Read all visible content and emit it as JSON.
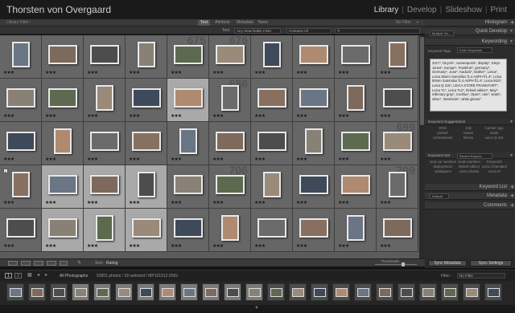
{
  "window": {
    "title": "Thorsten von Overgaard"
  },
  "modules": [
    {
      "label": "Library",
      "active": true
    },
    {
      "label": "Develop",
      "active": false
    },
    {
      "label": "Slideshow",
      "active": false
    },
    {
      "label": "Print",
      "active": false
    }
  ],
  "filter_bar": {
    "title": "Library Filter :",
    "tabs": [
      "Text",
      "Attribute",
      "Metadata",
      "None"
    ],
    "active_tab": "Text",
    "no_filter": "No Filter",
    "text_label": "Text",
    "field_select": "Any Searchable Field",
    "rule_select": "Contains All"
  },
  "grid": {
    "row_numbers": [
      [
        "",
        "",
        "",
        "",
        "675",
        "676",
        "",
        "",
        "",
        ""
      ],
      [
        "",
        "",
        "",
        "",
        "",
        "686",
        "",
        "",
        "",
        ""
      ],
      [
        "",
        "",
        "",
        "",
        "",
        "",
        "",
        "",
        "",
        "699"
      ],
      [
        "",
        "",
        "",
        "",
        "",
        "706",
        "",
        "",
        "",
        "709"
      ],
      [
        "",
        "",
        "",
        "",
        "",
        "",
        "",
        "",
        "",
        ""
      ]
    ],
    "badge_value": "2"
  },
  "toolbar": {
    "sort_label": "Sort:",
    "sort_value": "Rating",
    "thumbnails_label": "Thumbnails"
  },
  "right_panel": {
    "histogram": "Histogram",
    "quick_develop": "Quick Develop",
    "quick_develop_preset": "Multiple Se...",
    "keywording": "Keywording",
    "keyword_tags_label": "Keyword Tags",
    "keyword_tags_select": "Enter Keywords",
    "keywords_text": "2017*, bicycle*, camerapoint*, display*, Eleyn Jones*, Europe*, Frankfurt*, germany*, Germany*, June*, Kaduck*, leather*, Leica*, Leica 35mm Summilux f1.4 ASPH f/1.4*, Leica 50mm Summilux f1.4 ASPH f/1.4*, Leica M10*, Leica Q 116*, LEICA STORE FRANKFURT*, Leica TL*, Leica TL2*, limited edition*, May*, millenary gray*, noctilux*, Open*, rain*, seats*, silver*, Weinheim*, white gloves*",
    "keyword_suggestions": "Keyword Suggestions",
    "suggestions": [
      "2015",
      "July",
      "Carmel Ugo",
      "parked",
      "Kasse",
      "seats",
      "corneamovie",
      "fitness",
      "Leica Q 116"
    ],
    "keyword_set": "Keyword Set",
    "keyword_set_select": "Recent Keywor...",
    "set_keywords": [
      "seat car numbers",
      "seats numbers",
      "Keywords",
      "display/store",
      "limited edition",
      "Leica Chamaled",
      "wallpapers",
      "cover photos",
      "Leica M"
    ],
    "keyword_list": "Keyword List",
    "metadata": "Metadata",
    "metadata_preset": "Default",
    "comments": "Comments",
    "sync_metadata": "Sync Metadata",
    "sync_settings": "Sync Settings"
  },
  "filmstrip_bar": {
    "pages": [
      "1",
      "2"
    ],
    "source": "All Photographs",
    "info": "52901 photos / 18 selected / MP101912.DNG",
    "filter_label": "Filter :",
    "filter_value": "No Filter"
  }
}
